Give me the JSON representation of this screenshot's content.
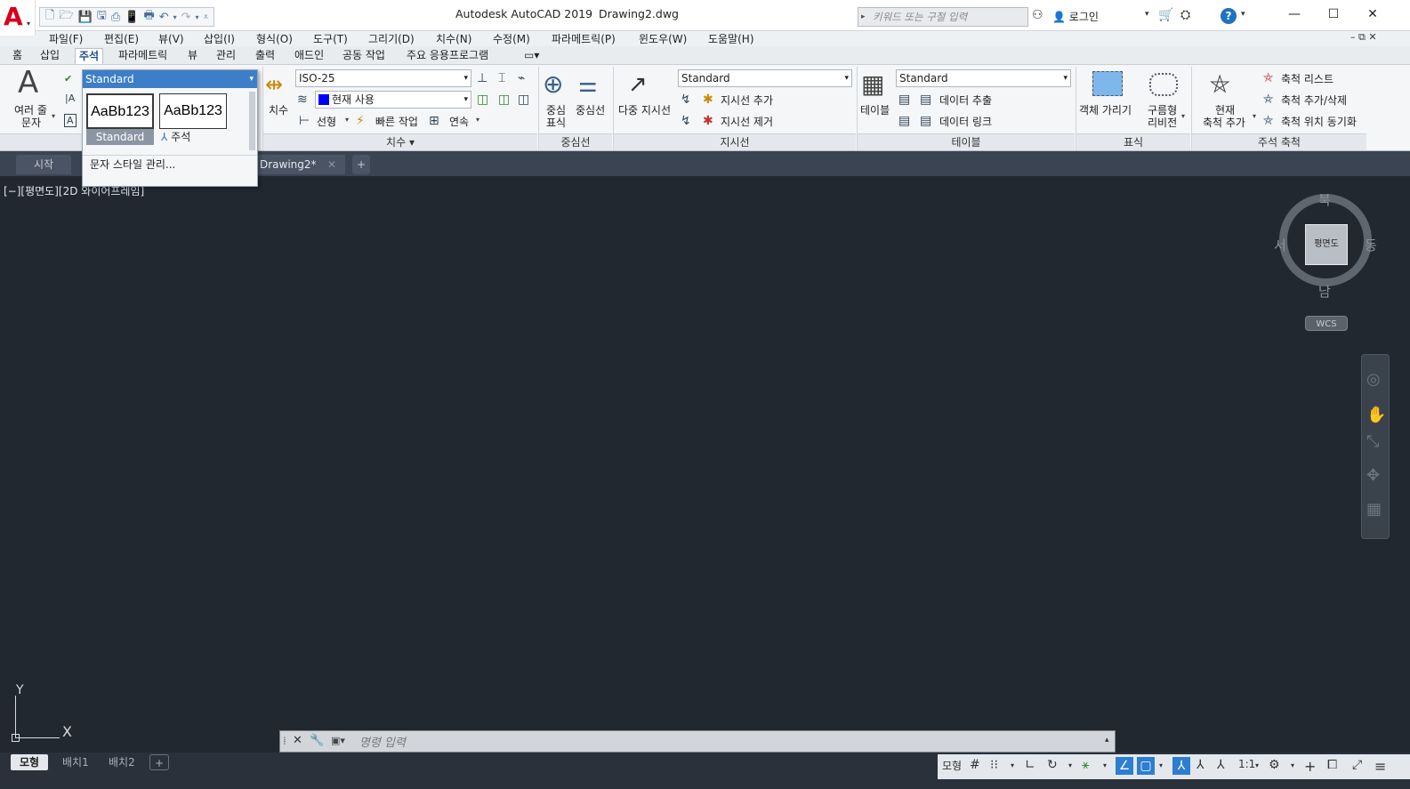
{
  "title_bar": {
    "app_title": "Autodesk AutoCAD 2019",
    "file_name": "Drawing2.dwg",
    "search_placeholder": "키워드 또는 구절 입력",
    "login": "로그인"
  },
  "menu": [
    "파일(F)",
    "편집(E)",
    "뷰(V)",
    "삽입(I)",
    "형식(O)",
    "도구(T)",
    "그리기(D)",
    "치수(N)",
    "수정(M)",
    "파라메트릭(P)",
    "윈도우(W)",
    "도움말(H)"
  ],
  "ribbon_tabs": [
    "홈",
    "삽입",
    "주석",
    "파라메트릭",
    "뷰",
    "관리",
    "출력",
    "애드인",
    "공동 작업",
    "주요 응용프로그램"
  ],
  "active_ribbon_tab": "주석",
  "text_panel": {
    "multiline_label_1": "여러 줄",
    "multiline_label_2": "문자",
    "style_combo": "Standard",
    "swatch1": "AaBb123",
    "swatch1_caption": "Standard",
    "swatch2": "AaBb123",
    "swatch2_caption": "주석",
    "manage_styles": "문자 스타일 관리..."
  },
  "dimension_panel": {
    "title": "치수",
    "big_button": "치수",
    "style_combo": "ISO-25",
    "layer_combo": "현재 사용",
    "linear": "선형",
    "quick": "빠른 작업",
    "continue": "연속"
  },
  "centerline_panel": {
    "title": "중심선",
    "center_mark_1": "중심",
    "center_mark_2": "표식",
    "centerline": "중심선"
  },
  "leader_panel": {
    "title": "지시선",
    "multileader": "다중 지시선",
    "style_combo": "Standard",
    "add": "지시선 추가",
    "remove": "지시선 제거"
  },
  "table_panel": {
    "title": "테이블",
    "table": "테이블",
    "style_combo": "Standard",
    "extract": "데이터 추출",
    "link": "데이터 링크"
  },
  "markup_panel": {
    "title": "표식",
    "wipeout": "객체 가리기",
    "revcloud_1": "구름형",
    "revcloud_2": "리비전"
  },
  "scale_panel": {
    "title": "주석 축척",
    "add_current_1": "현재",
    "add_current_2": "축척 추가",
    "scale_list": "축척 리스트",
    "add_delete": "축척 추가/삭제",
    "sync": "축척 위치 동기화"
  },
  "doc_tabs": {
    "start": "시작",
    "drawing": "Drawing2*"
  },
  "viewport_label": "[−][평면도][2D 와이어프레임]",
  "viewcube": {
    "face": "평면도",
    "north": "북",
    "south": "남",
    "east": "동",
    "west": "서",
    "wcs": "WCS"
  },
  "ucs": {
    "x": "X",
    "y": "Y"
  },
  "command_line": {
    "placeholder": "명령 입력"
  },
  "layout_tabs": [
    "모형",
    "배치1",
    "배치2"
  ],
  "status_bar": {
    "model": "모형",
    "scale": "1:1"
  }
}
